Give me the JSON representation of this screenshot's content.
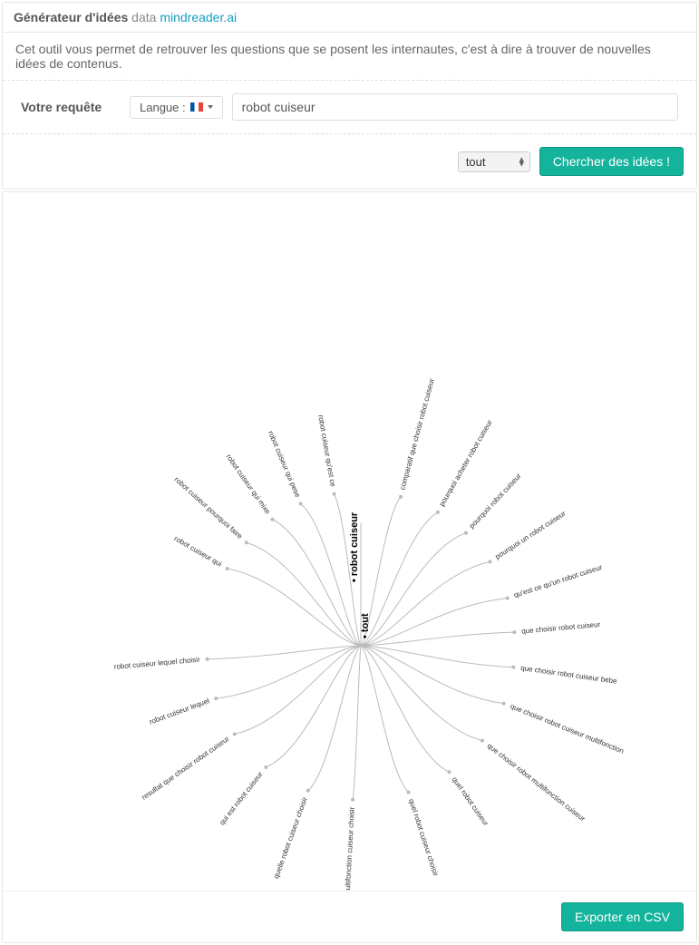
{
  "header": {
    "title_bold": "Générateur d'idées",
    "title_sub": "data",
    "link": "mindreader.ai"
  },
  "description": "Cet outil vous permet de retrouver les questions que se posent les internautes, c'est à dire à trouver de nouvelles idées de contenus.",
  "query": {
    "label": "Votre requête",
    "lang_label": "Langue :",
    "value": "robot cuiseur"
  },
  "filter": {
    "selected": "tout"
  },
  "buttons": {
    "search": "Chercher des idées !",
    "export": "Exporter en CSV"
  },
  "chart_data": {
    "type": "radial-tree",
    "center_label": "tout",
    "trunk_label": "• robot cuiseur",
    "branches": [
      {
        "angle_deg": -138,
        "text": "robot cuiseur pourquoi faire"
      },
      {
        "angle_deg": -150,
        "text": "robot cuiseur qui"
      },
      {
        "angle_deg": -125,
        "text": "robot cuiseur qui mixe"
      },
      {
        "angle_deg": -113,
        "text": "robot cuiseur qui pese"
      },
      {
        "angle_deg": -100,
        "text": "robot cuiseur qu'est ce"
      },
      {
        "angle_deg": -75,
        "text": "comparatif que choisir robot cuiseur"
      },
      {
        "angle_deg": -60,
        "text": "pourquoi acheter robot cuiseur"
      },
      {
        "angle_deg": -47,
        "text": "pourquoi robot cuiseur"
      },
      {
        "angle_deg": -33,
        "text": "pourquoi un robot cuiseur"
      },
      {
        "angle_deg": -18,
        "text": "qu'est ce qu'un robot cuiseur"
      },
      {
        "angle_deg": -5,
        "text": "que choisir robot cuiseur"
      },
      {
        "angle_deg": 8,
        "text": "que choisir robot cuiseur bebe"
      },
      {
        "angle_deg": 22,
        "text": "que choisir robot cuiseur multifonction"
      },
      {
        "angle_deg": 38,
        "text": "que choisir robot multifonction cuiseur"
      },
      {
        "angle_deg": 55,
        "text": "quel robot cuiseur"
      },
      {
        "angle_deg": 72,
        "text": "quel robot cuiseur choisir"
      },
      {
        "angle_deg": 93,
        "text": "robot multifonction cuiseur choisir"
      },
      {
        "angle_deg": 110,
        "text": "quelle robot cuiseur choisir"
      },
      {
        "angle_deg": 128,
        "text": "qui est robot cuiseur"
      },
      {
        "angle_deg": 145,
        "text": "resultat que choisir robot cuiseur"
      },
      {
        "angle_deg": 160,
        "text": "robot cuiseur lequel"
      },
      {
        "angle_deg": 175,
        "text": "robot cuiseur lequel choisir"
      }
    ]
  }
}
